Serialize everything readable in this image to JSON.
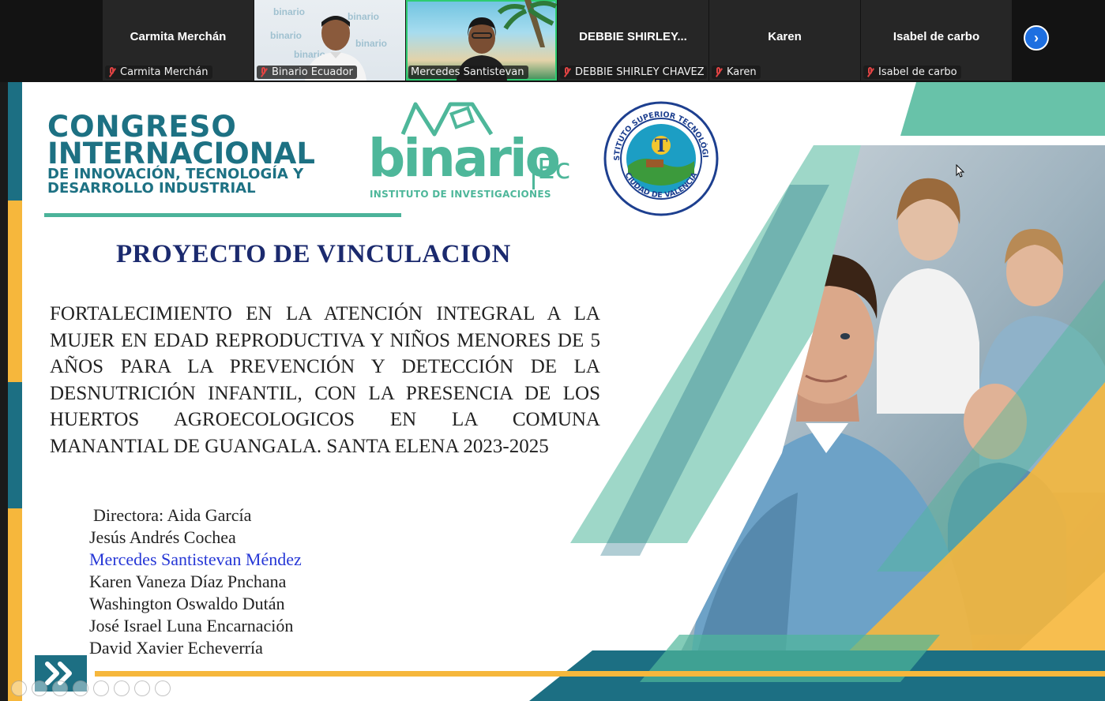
{
  "participants": [
    {
      "display_name": "Carmita Merchán",
      "label": "Carmita Merchán",
      "video": false
    },
    {
      "display_name": "",
      "label": "Binario Ecuador",
      "video": true
    },
    {
      "display_name": "",
      "label": "Mercedes Santistevan",
      "video": true,
      "speaking": true
    },
    {
      "display_name": "DEBBIE  SHIRLEY...",
      "label": "DEBBIE SHIRLEY CHAVEZ G...",
      "video": false
    },
    {
      "display_name": "Karen",
      "label": "Karen",
      "video": false
    },
    {
      "display_name": "Isabel de carbo",
      "label": "Isabel de carbo",
      "video": false
    }
  ],
  "next_page_icon": "chevron-right-icon",
  "slide": {
    "congreso": {
      "line1": "CONGRESO",
      "line2": "INTERNACIONAL",
      "line3": "DE INNOVACIÓN, TECNOLOGÍA Y",
      "line4": "DESARROLLO INDUSTRIAL"
    },
    "binario": {
      "word": "binario",
      "suffix": "Ec",
      "subtitle": "INSTITUTO DE INVESTIGACIONES"
    },
    "seal": {
      "top_text": "INSTITUTO SUPERIOR TECNOLÓGICO",
      "bottom_text": "CIUDAD DE VALENCIA"
    },
    "title": "PROYECTO DE VINCULACION",
    "body": "FORTALECIMIENTO EN LA ATENCIÓN INTEGRAL A LA MUJER EN EDAD REPRODUCTIVA Y NIÑOS MENORES DE 5 AÑOS PARA LA PREVENCIÓN Y DETECCIÓN DE LA DESNUTRICIÓN INFANTIL, CON LA PRESENCIA DE LOS HUERTOS AGROECOLOGICOS EN LA COMUNA MANANTIAL DE GUANGALA. SANTA ELENA 2023-2025",
    "team": [
      "Directora: Aida García",
      "Jesús Andrés Cochea",
      "Mercedes Santistevan Méndez",
      "Karen Vaneza Díaz Pnchana",
      "Washington Oswaldo Dután",
      "José Israel Luna Encarnación",
      "David Xavier Echeverría"
    ],
    "highlight_color": "#2637d6",
    "nav_icon": "double-chevron-right-icon"
  }
}
